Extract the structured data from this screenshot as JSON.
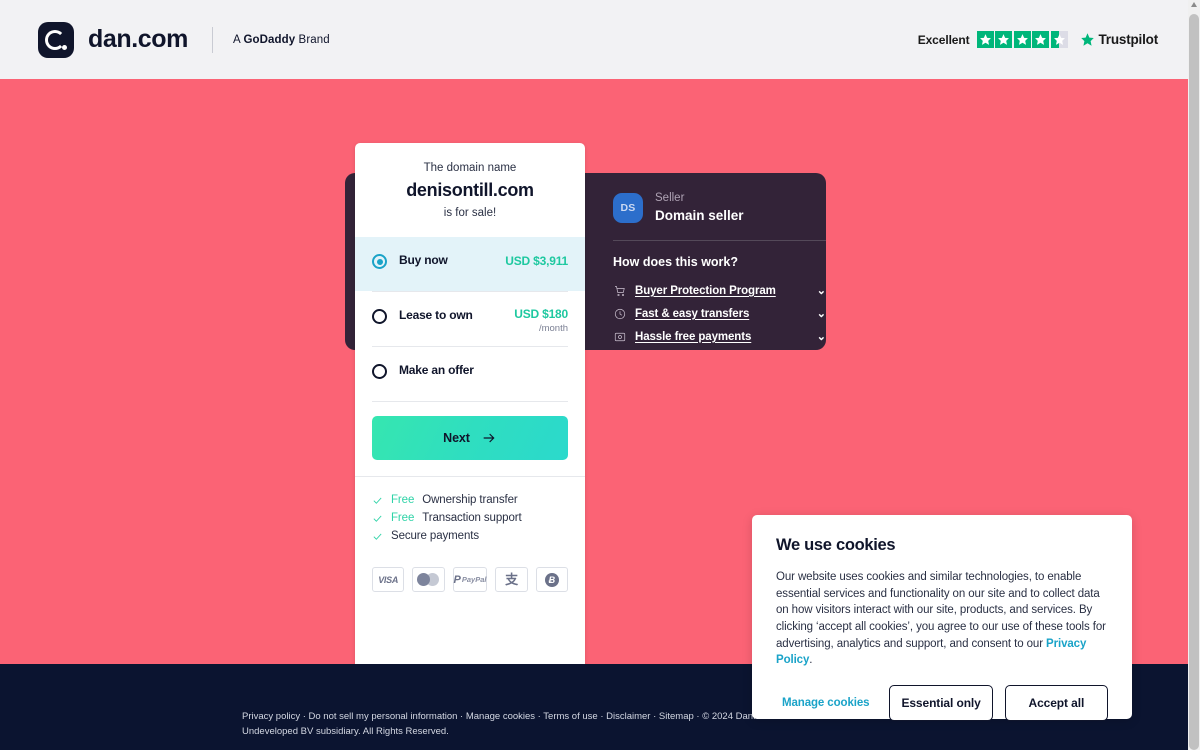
{
  "header": {
    "brand_name": "dan.com",
    "brand_sub_prefix": "A ",
    "brand_sub_bold": "GoDaddy",
    "brand_sub_suffix": " Brand",
    "trustpilot": {
      "rating_word": "Excellent",
      "stars": 4.5,
      "logo_text": "Trustpilot"
    }
  },
  "seller": {
    "role_label": "Seller",
    "name": "Domain seller",
    "avatar_initials": "DS",
    "how_title": "How does this work?",
    "items": [
      {
        "icon": "cart-icon",
        "label": "Buyer Protection Program"
      },
      {
        "icon": "clock-icon",
        "label": "Fast & easy transfers"
      },
      {
        "icon": "card-icon",
        "label": "Hassle free payments"
      }
    ]
  },
  "buy_card": {
    "domain_pre": "The domain name",
    "domain_name": "denisontill.com",
    "domain_post": "is for sale!",
    "options": [
      {
        "label": "Buy now",
        "price": "USD $3,911",
        "price_sub": "",
        "selected": true
      },
      {
        "label": "Lease to own",
        "price": "USD $180",
        "price_sub": "/month",
        "selected": false
      },
      {
        "label": "Make an offer",
        "price": "",
        "price_sub": "",
        "selected": false
      }
    ],
    "next_label": "Next",
    "features": [
      {
        "highlight": "Free",
        "text": "Ownership transfer"
      },
      {
        "highlight": "Free",
        "text": "Transaction support"
      },
      {
        "highlight": "",
        "text": "Secure payments"
      }
    ],
    "payment_methods": [
      "visa-icon",
      "mastercard-icon",
      "paypal-icon",
      "alipay-icon",
      "bitcoin-icon"
    ],
    "payment_labels": {
      "visa": "VISA",
      "paypal_p": "P",
      "paypal_text": "PayPal",
      "alipay": "支",
      "bitcoin": "Ƀ"
    }
  },
  "cookie_dialog": {
    "title": "We use cookies",
    "body": "Our website uses cookies and similar technologies, to enable essential services and functionality on our site and to collect data on how visitors interact with our site, products, and services. By clicking ‘accept all cookies’, you agree to our use of these tools for advertising, analytics and support, and consent to our ",
    "privacy_link": "Privacy Policy",
    "body_end": ".",
    "manage_label": "Manage cookies",
    "essential_label": "Essential only",
    "accept_label": "Accept all"
  },
  "footer": {
    "text": "Privacy policy · Do not sell my personal information · Manage cookies · Terms of use · Disclaimer · Sitemap · © 2024 Dan.com an Undeveloped BV subsidiary. All Rights Reserved."
  },
  "colors": {
    "background": "#FB6375",
    "seller_panel": "#332338",
    "accent_green": "#2ED3A7",
    "accent_blue": "#1AA3C8",
    "footer": "#0B1430"
  }
}
